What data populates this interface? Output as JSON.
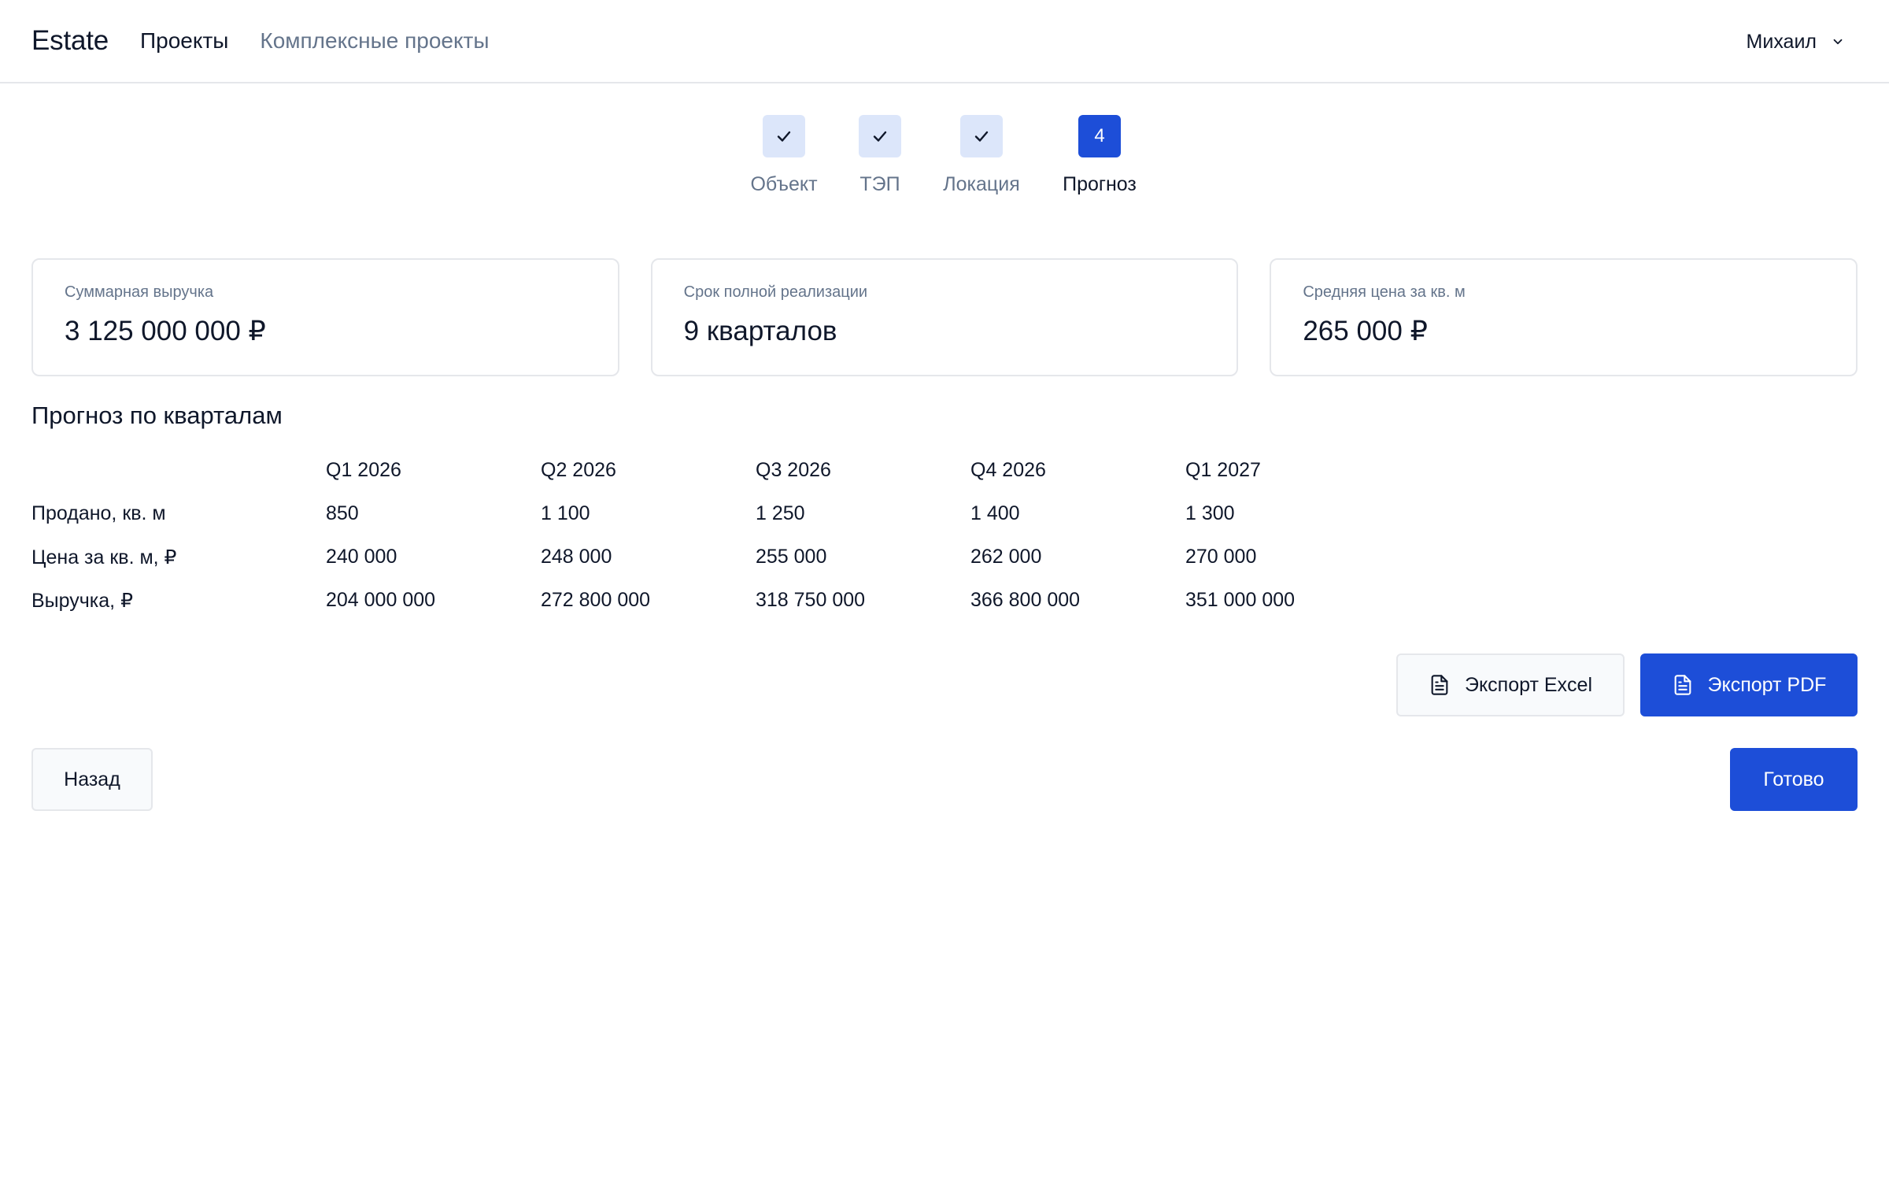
{
  "header": {
    "brand": "Estate",
    "nav": [
      {
        "label": "Проекты",
        "active": true
      },
      {
        "label": "Комплексные проекты",
        "active": false
      }
    ],
    "user": {
      "name": "Михаил",
      "icon": "chevron-down-icon"
    }
  },
  "stepper": {
    "steps": [
      {
        "label": "Объект",
        "state": "done",
        "icon": "check-icon"
      },
      {
        "label": "ТЭП",
        "state": "done",
        "icon": "check-icon"
      },
      {
        "label": "Локация",
        "state": "done",
        "icon": "check-icon"
      },
      {
        "label": "Прогноз",
        "state": "current",
        "number": "4"
      }
    ]
  },
  "stats": [
    {
      "label": "Суммарная выручка",
      "value": "3 125 000 000 ₽"
    },
    {
      "label": "Срок полной реализации",
      "value": "9 кварталов"
    },
    {
      "label": "Средняя цена за кв. м",
      "value": "265 000 ₽"
    }
  ],
  "forecast": {
    "title": "Прогноз по кварталам",
    "columns": [
      "Q1 2026",
      "Q2 2026",
      "Q3 2026",
      "Q4 2026",
      "Q1 2027"
    ],
    "rows": [
      {
        "label": "Продано, кв. м",
        "values": [
          "850",
          "1 100",
          "1 250",
          "1 400",
          "1 300"
        ]
      },
      {
        "label": "Цена за кв. м, ₽",
        "values": [
          "240 000",
          "248 000",
          "255 000",
          "262 000",
          "270 000"
        ]
      },
      {
        "label": "Выручка, ₽",
        "values": [
          "204 000 000",
          "272 800 000",
          "318 750 000",
          "366 800 000",
          "351 000 000"
        ]
      }
    ]
  },
  "actions": {
    "export_excel": "Экспорт Excel",
    "export_pdf": "Экспорт PDF",
    "back": "Назад",
    "done": "Готово",
    "file_icon": "file-text-icon"
  },
  "colors": {
    "primary": "#1d4ed8",
    "step_done_bg": "#dce6fa",
    "muted_text": "#64748b",
    "border": "#e5e7eb"
  }
}
